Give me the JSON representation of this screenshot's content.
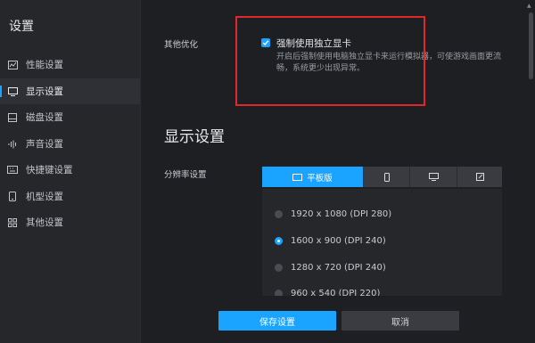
{
  "sidebar": {
    "title": "设置",
    "items": [
      {
        "label": "性能设置",
        "icon": "performance-icon"
      },
      {
        "label": "显示设置",
        "icon": "monitor-icon",
        "active": true
      },
      {
        "label": "磁盘设置",
        "icon": "disk-icon"
      },
      {
        "label": "声音设置",
        "icon": "sound-icon"
      },
      {
        "label": "快捷键设置",
        "icon": "keyboard-icon"
      },
      {
        "label": "机型设置",
        "icon": "phone-icon"
      },
      {
        "label": "其他设置",
        "icon": "grid-icon"
      }
    ]
  },
  "other_opt": {
    "label": "其他优化",
    "checkbox_label": "强制使用独立显卡",
    "checked": true,
    "description": "开启后强制使用电脑独立显卡来运行模拟器，可使游戏画面更流畅，系统更少出现异常。"
  },
  "display": {
    "section_title": "显示设置",
    "resolution_label": "分辨率设置",
    "tabs": [
      {
        "label": "平板版",
        "icon": "tablet-icon",
        "active": true
      },
      {
        "label": "",
        "icon": "phone-icon"
      },
      {
        "label": "",
        "icon": "monitor-icon"
      },
      {
        "label": "",
        "icon": "custom-edit-icon"
      }
    ],
    "resolutions": [
      {
        "label": "1920 x 1080 (DPI 280)",
        "checked": false
      },
      {
        "label": "1600 x 900 (DPI 240)",
        "checked": true
      },
      {
        "label": "1280 x 720 (DPI 240)",
        "checked": false
      },
      {
        "label": "960 x 540 (DPI 220)",
        "checked": false
      }
    ]
  },
  "footer": {
    "save_label": "保存设置",
    "cancel_label": "取消"
  },
  "colors": {
    "accent": "#1aa3ff",
    "highlight_border": "#e0282c",
    "background": "#1e1f23",
    "sidebar": "#26272b"
  }
}
